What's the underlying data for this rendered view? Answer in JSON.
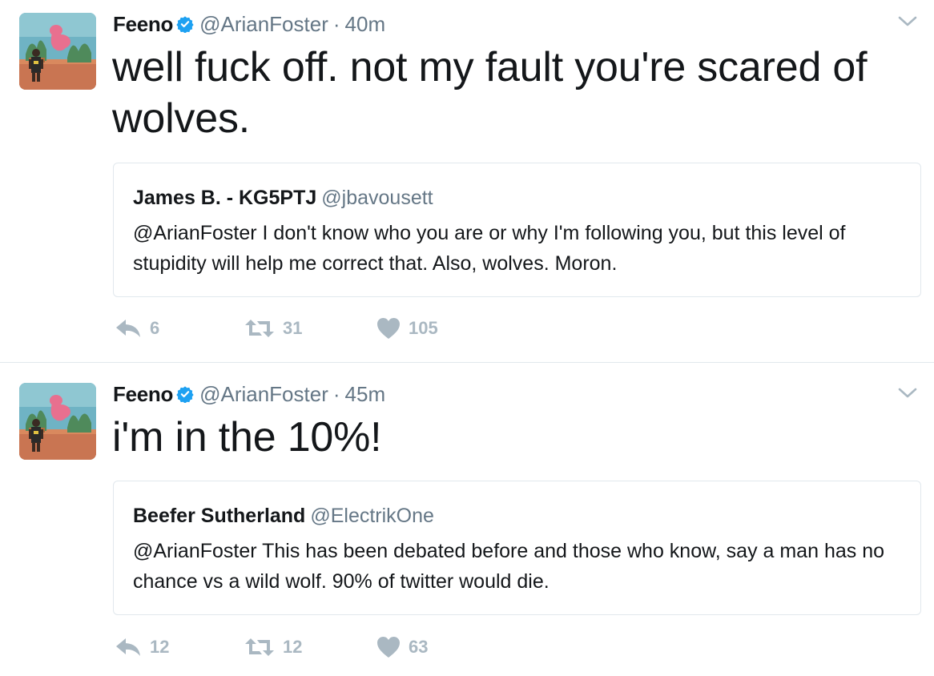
{
  "tweets": [
    {
      "author": {
        "display_name": "Feeno",
        "handle": "@ArianFoster",
        "verified": true
      },
      "time": "40m",
      "text": "well fuck off. not my fault you're scared of wolves.",
      "quoted": {
        "display_name": "James B. - KG5PTJ",
        "handle": "@jbavousett",
        "text": "@ArianFoster I don't know who you are or why I'm following you, but this level of stupidity will help me correct that. Also, wolves.  Moron."
      },
      "stats": {
        "replies": "6",
        "retweets": "31",
        "likes": "105"
      }
    },
    {
      "author": {
        "display_name": "Feeno",
        "handle": "@ArianFoster",
        "verified": true
      },
      "time": "45m",
      "text": "i'm in the 10%!",
      "quoted": {
        "display_name": "Beefer Sutherland",
        "handle": "@ElectrikOne",
        "text": "@ArianFoster This has been debated before and those who know, say a man has no chance vs a wild wolf. 90% of twitter would die."
      },
      "stats": {
        "replies": "12",
        "retweets": "12",
        "likes": "63"
      }
    }
  ],
  "icons": {
    "verified": "verified-badge-icon",
    "caret": "chevron-down-icon",
    "reply": "reply-icon",
    "retweet": "retweet-icon",
    "like": "heart-icon"
  },
  "colors": {
    "text": "#14171a",
    "secondary": "#657786",
    "action": "#aab8c2",
    "verified": "#1da1f2",
    "border": "#e1e8ed"
  }
}
